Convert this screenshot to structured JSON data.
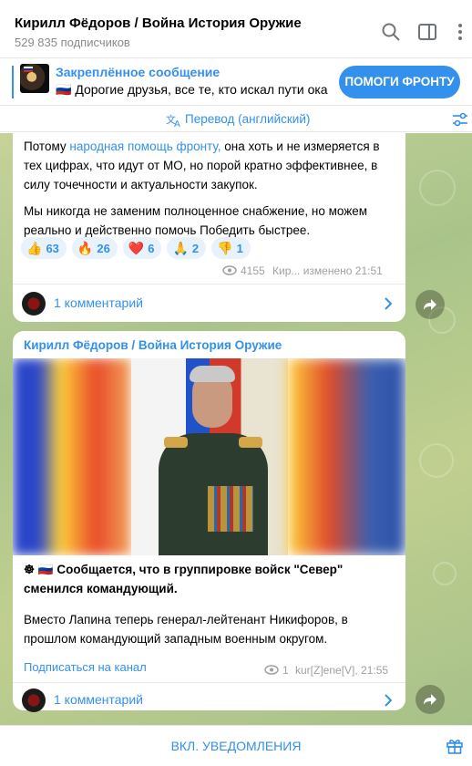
{
  "header": {
    "title": "Кирилл Фёдоров / Война История Оружие",
    "subtitle": "529 835 подписчиков"
  },
  "pinned": {
    "title": "Закреплённое сообщение",
    "text": "🇷🇺 Дорогие друзья, все те, кто искал пути ока…",
    "button_label": "ПОМОГИ ФРОНТУ"
  },
  "translate_bar": {
    "label": "Перевод (английский)"
  },
  "messages": [
    {
      "text_before_link": "Потому ",
      "link_text": "народная помощь фронту,",
      "text_after_link": " она хоть и не измеряется в тех цифрах, что идут от МО, но порой кратно эффективнее, в силу точечности и актуальности закупок.",
      "paragraph2": "Мы никогда не заменим полноценное снабжение, но можем реально и действенно помочь Победить быстрее.",
      "reactions": [
        {
          "emoji": "👍",
          "count": "63"
        },
        {
          "emoji": "🔥",
          "count": "26"
        },
        {
          "emoji": "❤️",
          "count": "6"
        },
        {
          "emoji": "🙏",
          "count": "2"
        },
        {
          "emoji": "👎",
          "count": "1"
        }
      ],
      "views": "4155",
      "meta_text": "Кир... изменено 21:51",
      "comments_label": "1 комментарий"
    },
    {
      "sender": "Кирилл Фёдоров / Война История Оружие",
      "text_line1": "☸ 🇷🇺 Сообщается, что в группировке войск \"Север\" сменился командующий.",
      "text_line2": "Вместо Лапина теперь генерал-лейтенант Никифоров, в прошлом командующий западным военным округом.",
      "subscribe_label": "Подписаться на канал",
      "views": "1",
      "meta_text": "kur[Z]ene[V], 21:55",
      "comments_label": "1 комментарий"
    }
  ],
  "bottom_bar": {
    "label": "ВКЛ. УВЕДОМЛЕНИЯ"
  },
  "icons": [
    "search-icon",
    "sidebar-toggle-icon",
    "more-vertical-icon",
    "translate-icon",
    "settings-sliders-icon",
    "eye-icon",
    "chevron-right-icon",
    "share-icon",
    "gift-icon"
  ],
  "colors": {
    "accent": "#3390ec",
    "meta": "#a0a0a0",
    "reaction_bg": "#e8f2fd"
  }
}
